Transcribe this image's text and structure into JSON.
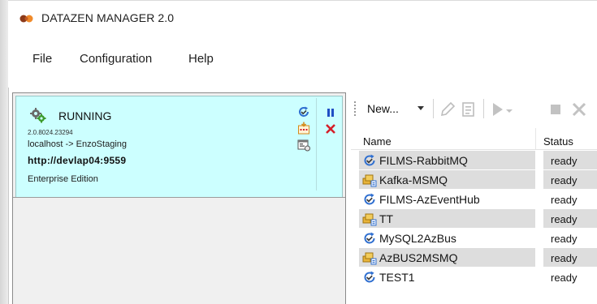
{
  "window": {
    "title": "DATAZEN MANAGER 2.0"
  },
  "menu": {
    "items": [
      "File",
      "Configuration",
      "Help"
    ]
  },
  "server": {
    "status": "RUNNING",
    "version": "2.0.8024.23294",
    "connection": "localhost -> EnzoStaging",
    "url": "http://devlap04:9559",
    "edition": "Enterprise Edition"
  },
  "toolbar": {
    "new_label": "New..."
  },
  "jobs": {
    "columns": {
      "name": "Name",
      "status": "Status"
    },
    "rows": [
      {
        "name": "FILMS-RabbitMQ",
        "status": "ready",
        "icon": "refresh-check-icon",
        "shaded": true
      },
      {
        "name": "Kafka-MSMQ",
        "status": "ready",
        "icon": "queue-icon",
        "shaded": true
      },
      {
        "name": "FILMS-AzEventHub",
        "status": "ready",
        "icon": "refresh-check-icon",
        "shaded": false
      },
      {
        "name": "TT",
        "status": "ready",
        "icon": "queue-icon",
        "shaded": true
      },
      {
        "name": "MySQL2AzBus",
        "status": "ready",
        "icon": "refresh-check-icon",
        "shaded": false
      },
      {
        "name": "AzBUS2MSMQ",
        "status": "ready",
        "icon": "queue-icon",
        "shaded": true
      },
      {
        "name": "TEST1",
        "status": "ready",
        "icon": "refresh-check-icon",
        "shaded": false
      }
    ]
  },
  "colors": {
    "card_background": "#ccffff",
    "pause_blue": "#1f4fc4",
    "stop_red": "#d4202a",
    "row_shade": "#dddddd"
  }
}
